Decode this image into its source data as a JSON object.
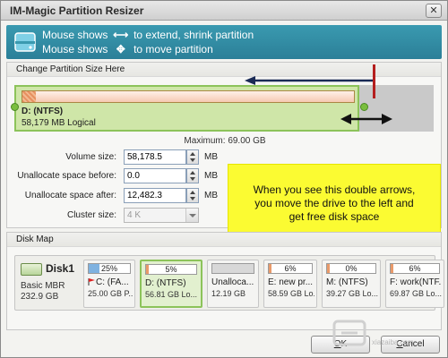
{
  "window": {
    "title": "IM-Magic Partition Resizer",
    "close_glyph": "✕"
  },
  "banner": {
    "line1_prefix": "Mouse shows",
    "line1_arrow": "⟷",
    "line1_suffix": "to extend, shrink partition",
    "line2_prefix": "Mouse shows",
    "line2_arrow": "✥",
    "line2_suffix": "to move partition",
    "icon": "disk-icon"
  },
  "resize": {
    "group_title": "Change Partition Size Here",
    "partition_label": "D: (NTFS)",
    "partition_sub": "58,179 MB Logical",
    "maximum_label": "Maximum: 69.00 GB",
    "used_fraction": 0.04
  },
  "fields": {
    "volume_size_label": "Volume size:",
    "volume_size_value": "58,178.5",
    "unalloc_before_label": "Unallocate space before:",
    "unalloc_before_value": "0.0",
    "unalloc_after_label": "Unallocate space after:",
    "unalloc_after_value": "12,482.3",
    "cluster_size_label": "Cluster size:",
    "cluster_size_value": "4 K",
    "unit": "MB"
  },
  "annotation": {
    "line1": "When you see this double arrows,",
    "line2": "you move the drive to the left and",
    "line3": "get free disk space",
    "colors": {
      "note_bg": "#fbfb32",
      "arrow_red": "#b41e1e",
      "arrow_navy": "#1a2a55"
    }
  },
  "disk_map": {
    "group_title": "Disk Map",
    "disk": {
      "name": "Disk1",
      "type": "Basic MBR",
      "size": "232.9 GB"
    },
    "partitions": [
      {
        "percent": "25%",
        "used": 0.25,
        "name": "C: (FA...",
        "meta": "25.00 GB P...",
        "fill": "#7fb2e0",
        "flag": true,
        "selected": false
      },
      {
        "percent": "5%",
        "used": 0.05,
        "name": "D: (NTFS)",
        "meta": "56.81 GB Lo...",
        "fill": "#e99a6a",
        "flag": false,
        "selected": true
      },
      {
        "percent": "",
        "used": 0,
        "name": "Unalloca...",
        "meta": "12.19 GB",
        "fill": "#d8d8d8",
        "flag": false,
        "selected": false
      },
      {
        "percent": "6%",
        "used": 0.06,
        "name": "E: new pr...",
        "meta": "58.59 GB Lo...",
        "fill": "#e99a6a",
        "flag": false,
        "selected": false
      },
      {
        "percent": "0%",
        "used": 0.0,
        "name": "M: (NTFS)",
        "meta": "39.27 GB Lo...",
        "fill": "#e99a6a",
        "flag": false,
        "selected": false
      },
      {
        "percent": "6%",
        "used": 0.06,
        "name": "F: work(NTF...",
        "meta": "69.87 GB Lo...",
        "fill": "#e99a6a",
        "flag": false,
        "selected": false
      }
    ]
  },
  "buttons": {
    "ok_mnemonic": "O",
    "ok_rest": "K",
    "cancel_mnemonic": "C",
    "cancel_rest": "ancel"
  },
  "watermark": {
    "text": "xiazaiba.com"
  }
}
